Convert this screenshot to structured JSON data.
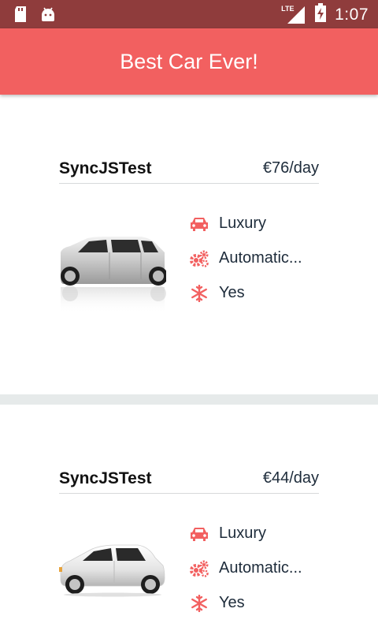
{
  "status_bar": {
    "time": "1:07",
    "network": "LTE"
  },
  "app_bar": {
    "title": "Best Car Ever!",
    "color": "#f26060"
  },
  "accent_color": "#f26060",
  "cars": [
    {
      "name": "SyncJSTest",
      "price": "€76/day",
      "features": [
        {
          "icon": "car-icon",
          "text": "Luxury"
        },
        {
          "icon": "gears-icon",
          "text": "Automatic..."
        },
        {
          "icon": "snowflake-icon",
          "text": "Yes"
        }
      ]
    },
    {
      "name": "SyncJSTest",
      "price": "€44/day",
      "features": [
        {
          "icon": "car-icon",
          "text": "Luxury"
        },
        {
          "icon": "gears-icon",
          "text": "Automatic..."
        },
        {
          "icon": "snowflake-icon",
          "text": "Yes"
        }
      ]
    }
  ]
}
